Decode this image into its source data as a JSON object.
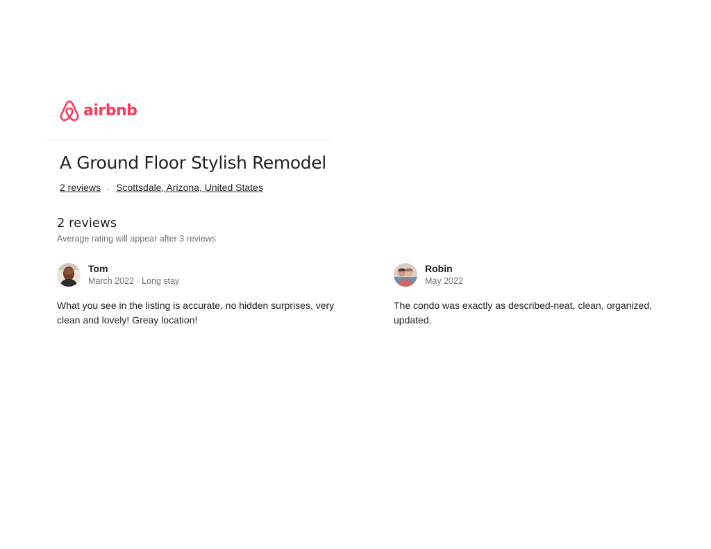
{
  "brand": {
    "name": "airbnb",
    "color": "#FF385C"
  },
  "listing": {
    "title": "A Ground Floor Stylish Remodel",
    "reviews_link": "2 reviews",
    "separator": "·",
    "location": "Scottsdale, Arizona, United States"
  },
  "reviews_section": {
    "heading": "2 reviews",
    "rating_note": "Average rating will appear after 3 reviews",
    "reviews": [
      {
        "name": "Tom",
        "date": "March 2022 · Long stay",
        "text": "What you see in the listing is accurate, no hidden surprises, very clean and lovely! Greay location!"
      },
      {
        "name": "Robin",
        "date": "May 2022",
        "text": "The condo was exactly as described-neat, clean, organized, updated."
      }
    ]
  }
}
